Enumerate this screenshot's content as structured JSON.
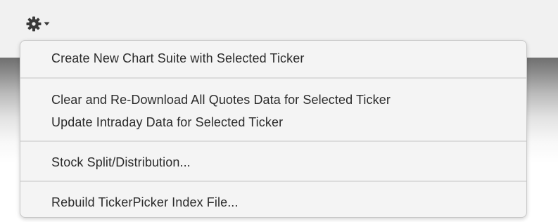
{
  "toolbar": {
    "gear_icon": "gear-icon",
    "dropdown_indicator": "chevron-down-icon"
  },
  "menu": {
    "items": [
      {
        "label": "Create New Chart Suite with Selected Ticker"
      },
      {
        "label": "Clear and Re-Download All Quotes Data for Selected Ticker"
      },
      {
        "label": "Update Intraday Data for Selected Ticker"
      },
      {
        "label": "Stock Split/Distribution..."
      },
      {
        "label": "Rebuild TickerPicker Index File..."
      }
    ]
  },
  "colors": {
    "menu_background": "#f4f4f4",
    "menu_text": "#2b2b2b",
    "separator": "#dcdcdc",
    "toolbar_background": "#f1f1f1"
  }
}
